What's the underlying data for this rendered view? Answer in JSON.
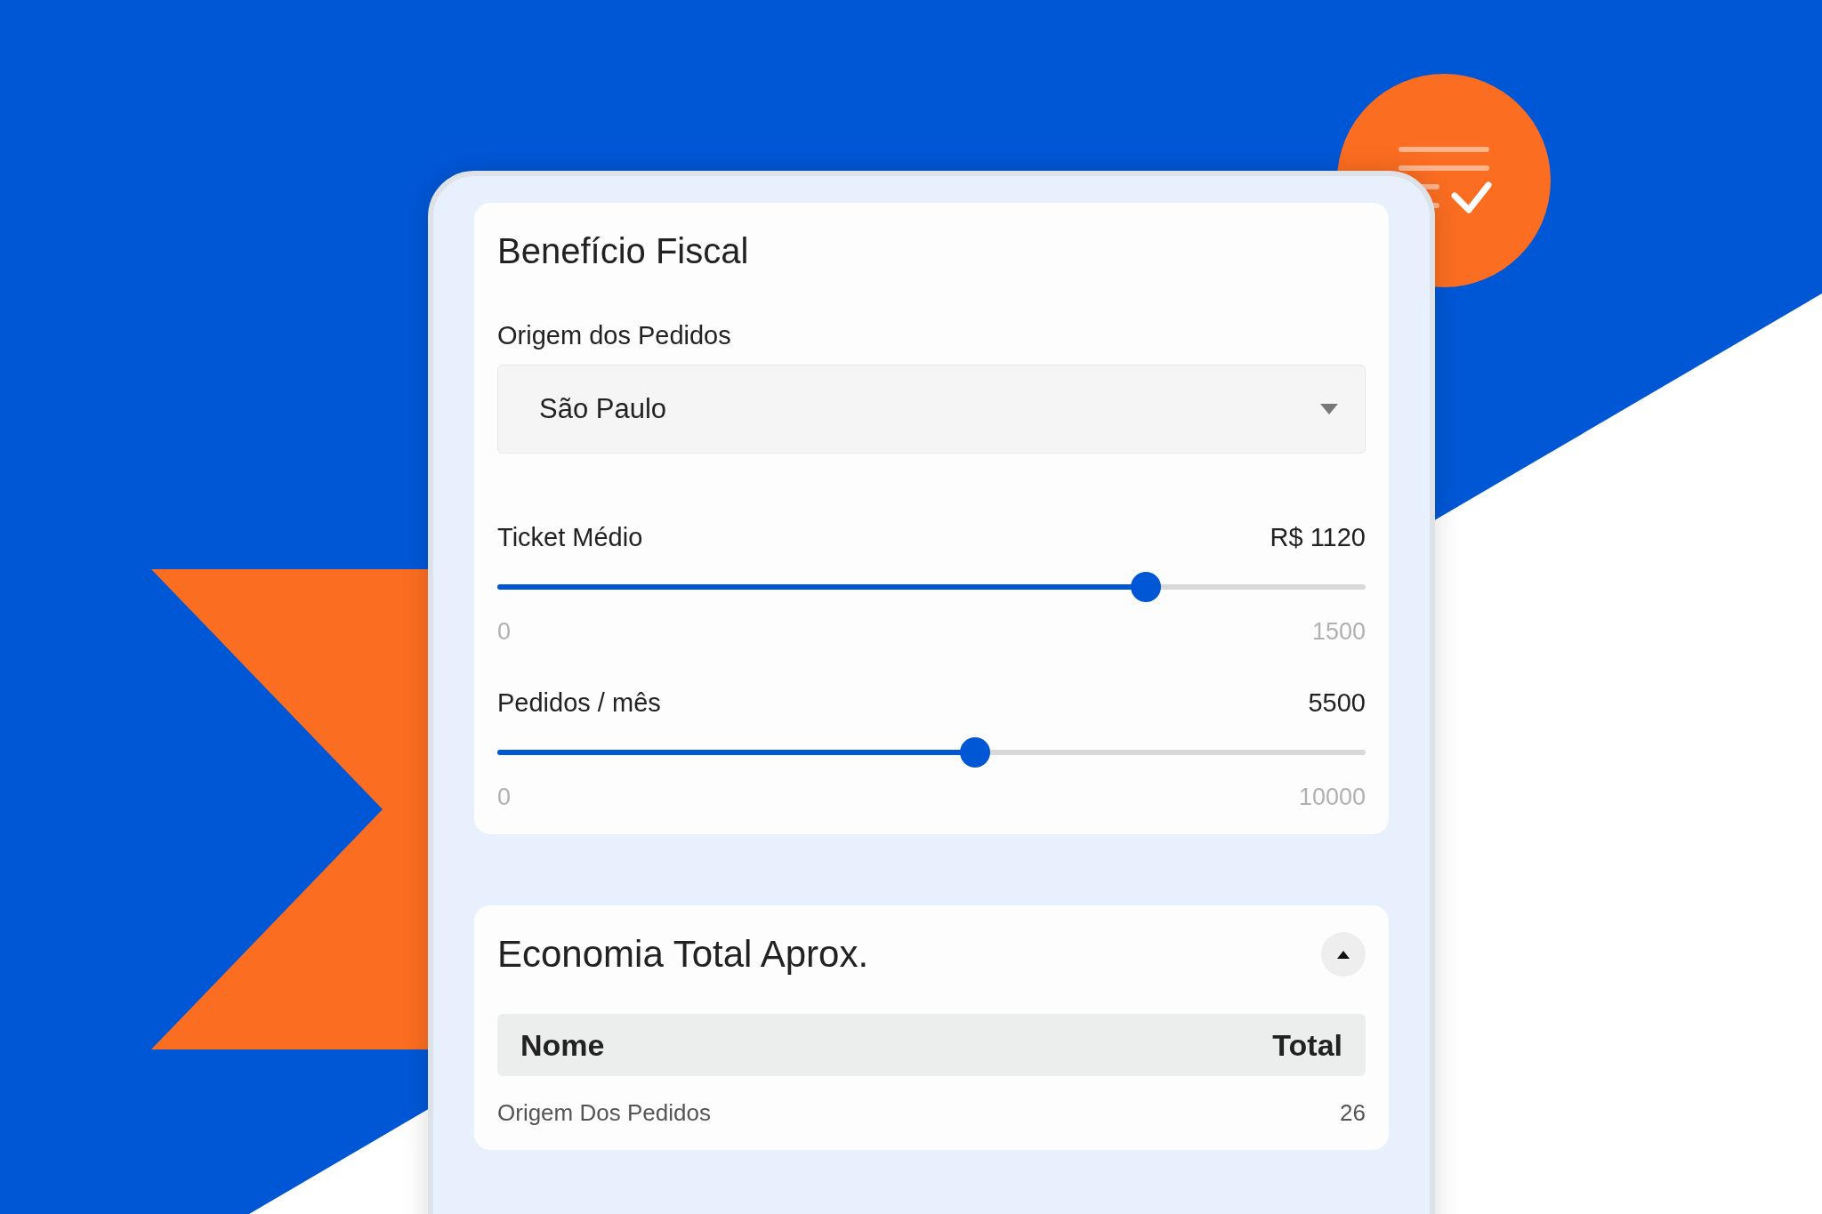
{
  "panel": {
    "title": "Benefício Fiscal",
    "select": {
      "label": "Origem dos Pedidos",
      "value": "São Paulo"
    },
    "sliders": [
      {
        "label": "Ticket Médio",
        "reading": "R$ 1120",
        "level": 0.747,
        "min": "0",
        "max": "1500"
      },
      {
        "label": "Pedidos / mês",
        "reading": "5500",
        "level": 0.55,
        "min": "0",
        "max": "10000"
      }
    ]
  },
  "summary": {
    "title": "Economia Total Aprox.",
    "expanded": true,
    "table": {
      "columns": [
        "Nome",
        "Total"
      ],
      "rows": [
        [
          "Origem Dos Pedidos",
          "26"
        ]
      ]
    }
  }
}
